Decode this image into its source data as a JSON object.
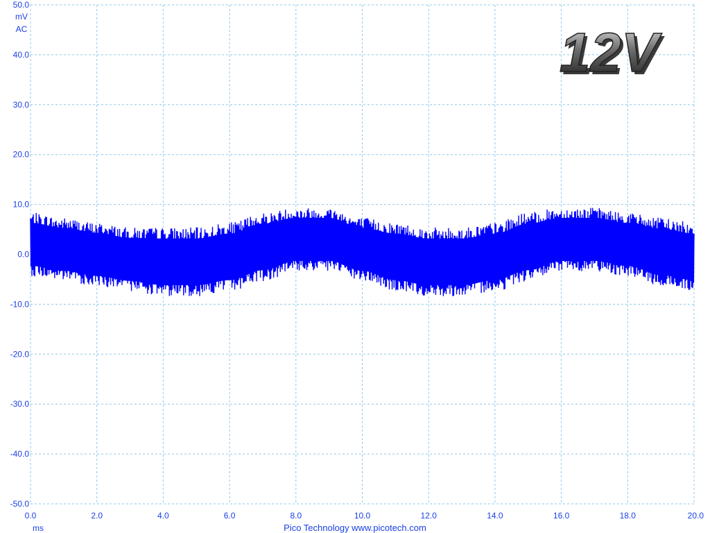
{
  "chart_data": {
    "type": "line",
    "title": "",
    "xlabel": "",
    "ylabel": "",
    "y_units": [
      "mV",
      "AC"
    ],
    "x_unit": "ms",
    "xlim": [
      0,
      20
    ],
    "ylim": [
      -50,
      50
    ],
    "x_ticks": [
      "0.0",
      "2.0",
      "4.0",
      "6.0",
      "8.0",
      "10.0",
      "12.0",
      "14.0",
      "16.0",
      "18.0",
      "20.0"
    ],
    "y_ticks": [
      "50.0",
      "40.0",
      "30.0",
      "20.0",
      "10.0",
      "0.0",
      "-10.0",
      "-20.0",
      "-30.0",
      "-40.0",
      "-50.0"
    ],
    "grid": true,
    "grid_style": "dashed",
    "series": [
      {
        "color": "#0000ff",
        "x": [
          0,
          1,
          2,
          3,
          4,
          5,
          6,
          7,
          8,
          9,
          10,
          11,
          12,
          13,
          14,
          15,
          16,
          17,
          18,
          19,
          20
        ],
        "upper": [
          8,
          7,
          6,
          5,
          5,
          5,
          6,
          8,
          9,
          9,
          7,
          6,
          5,
          5,
          6,
          8,
          9,
          9,
          8,
          7,
          6
        ],
        "lower": [
          -4,
          -5,
          -6,
          -7,
          -8,
          -8,
          -7,
          -5,
          -3,
          -3,
          -5,
          -7,
          -8,
          -8,
          -7,
          -5,
          -3,
          -3,
          -4,
          -6,
          -7
        ]
      }
    ]
  },
  "overlay": {
    "voltage_badge": "12V",
    "credit": "Pico Technology  www.picotech.com"
  },
  "colors": {
    "trace": "#0000ff",
    "axis_text": "#1a3ee6",
    "grid": "#8cc8e8"
  }
}
